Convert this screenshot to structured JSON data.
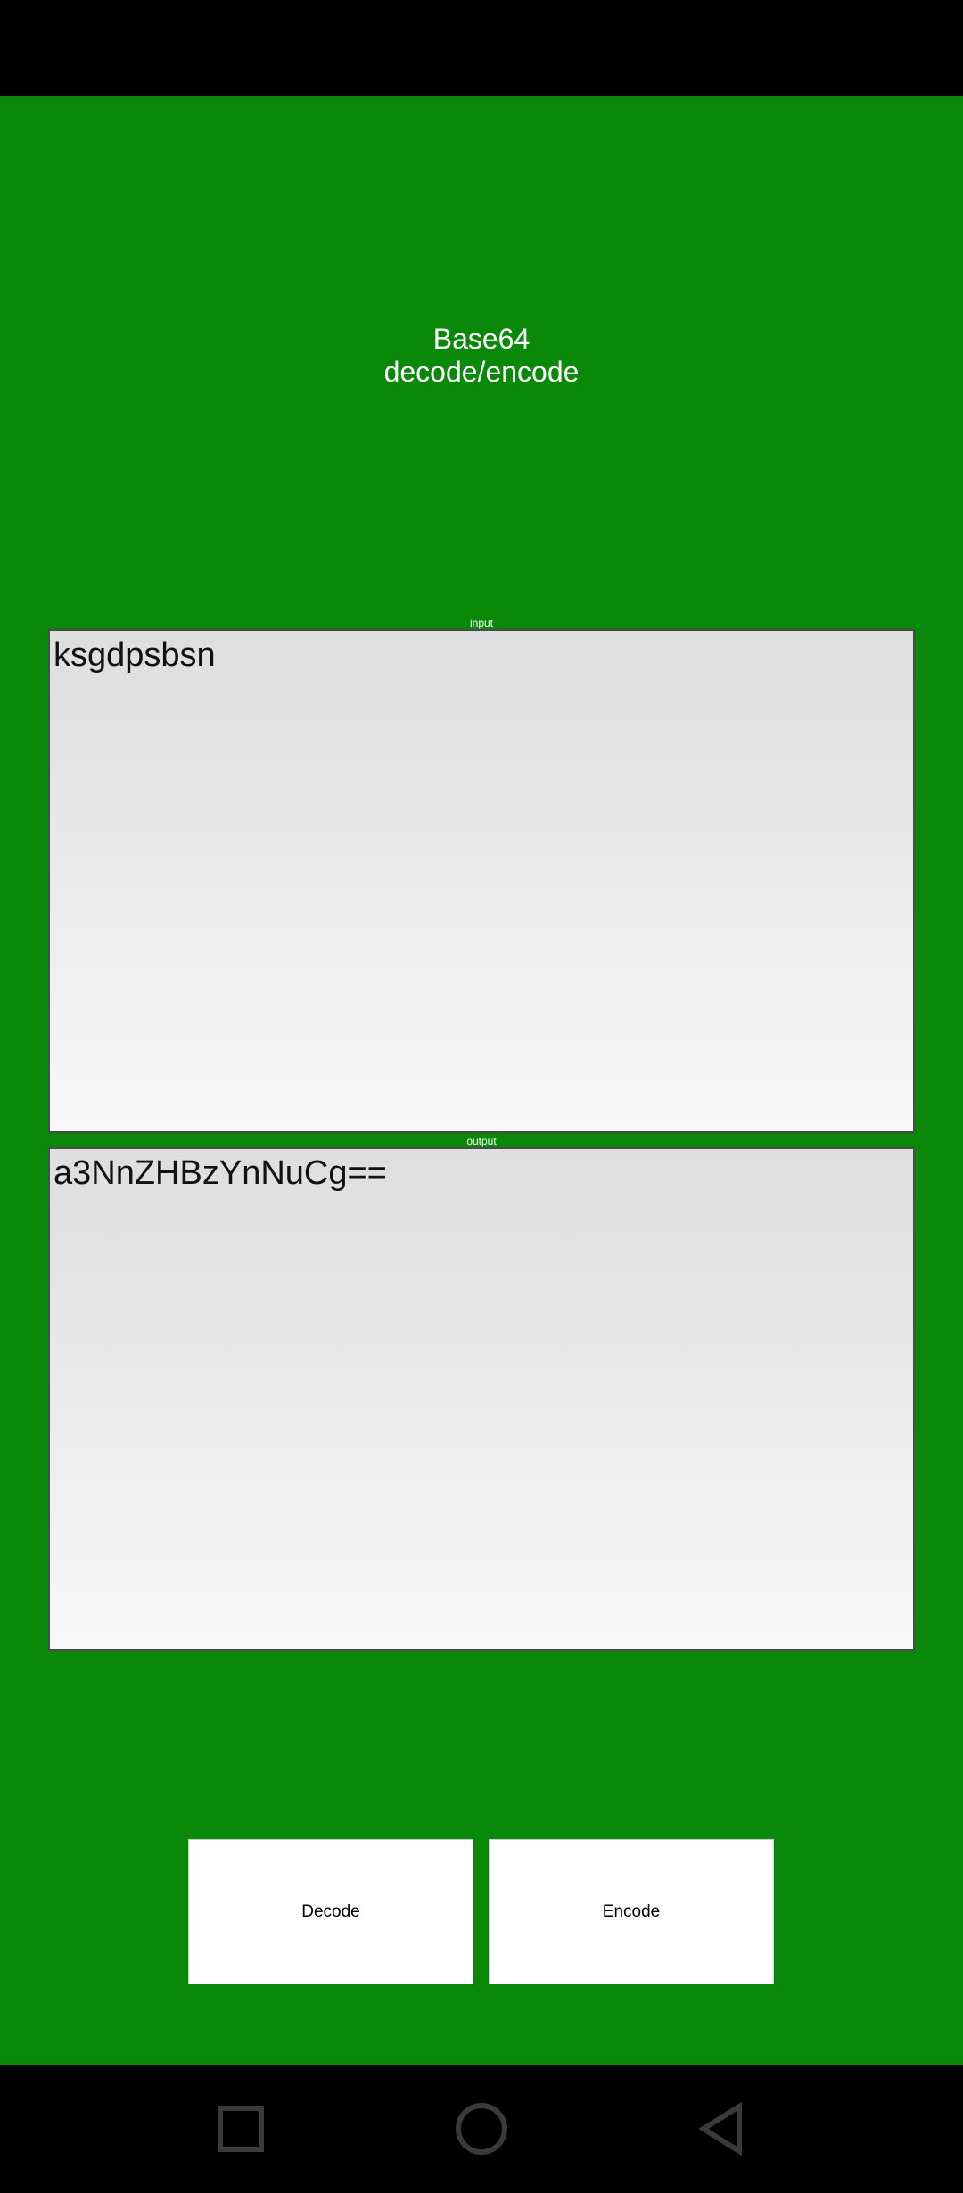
{
  "app": {
    "title_line1": "Base64",
    "title_line2": "decode/encode",
    "background_color": "#0a880a"
  },
  "input": {
    "label": "input",
    "value": "ksgdpsbsn"
  },
  "output": {
    "label": "output",
    "value": "a3NnZHBzYnNuCg=="
  },
  "buttons": {
    "decode_label": "Decode",
    "encode_label": "Encode"
  },
  "nav": {
    "items": [
      {
        "icon": "square-icon",
        "action": "recents"
      },
      {
        "icon": "circle-icon",
        "action": "home"
      },
      {
        "icon": "triangle-back-icon",
        "action": "back"
      }
    ]
  }
}
